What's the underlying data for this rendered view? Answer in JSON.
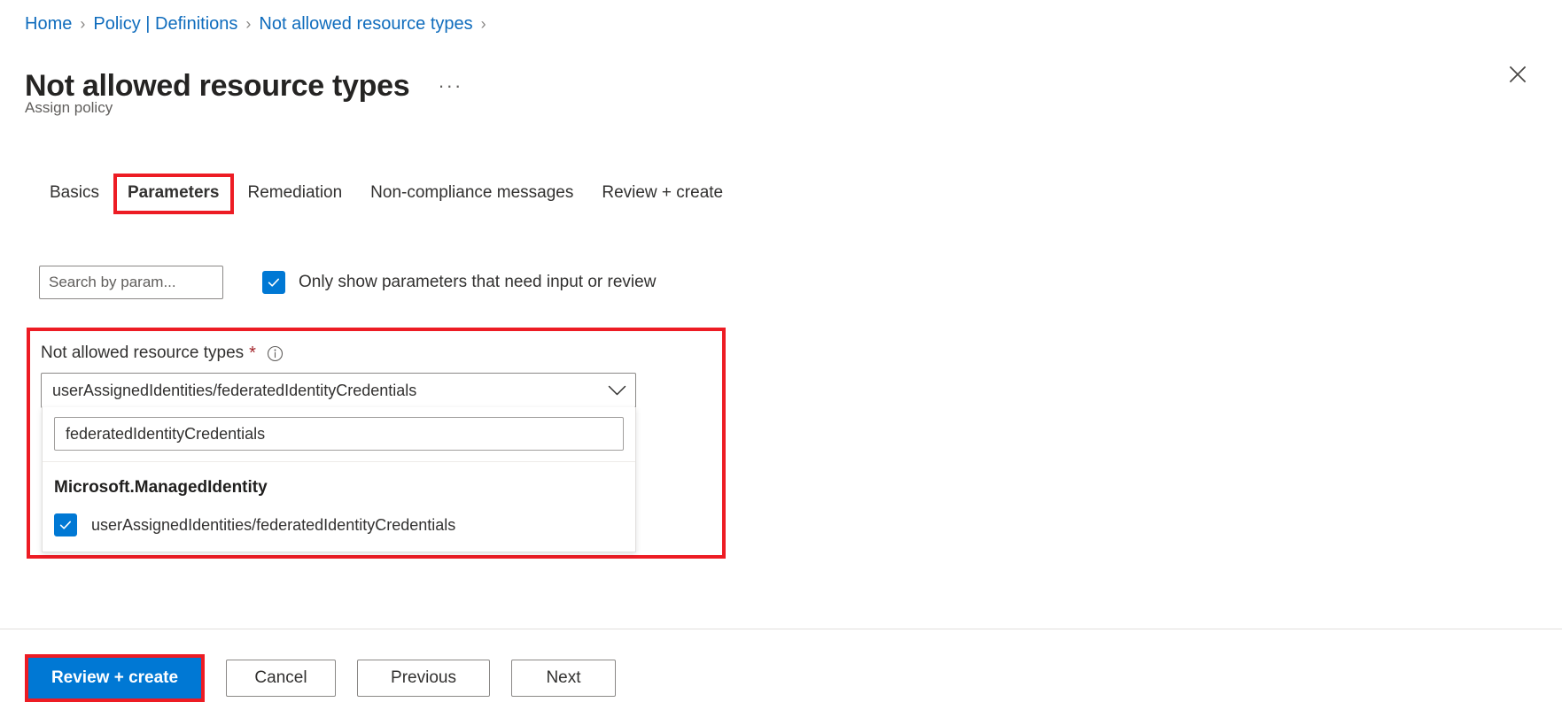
{
  "breadcrumb": {
    "separator": "›",
    "items": [
      {
        "label": "Home"
      },
      {
        "label": "Policy | Definitions"
      },
      {
        "label": "Not allowed resource types"
      }
    ]
  },
  "header": {
    "title": "Not allowed resource types",
    "subtitle": "Assign policy",
    "more_menu": "···",
    "close_icon": "close-icon"
  },
  "tabs": [
    {
      "label": "Basics",
      "active": false,
      "highlighted": false
    },
    {
      "label": "Parameters",
      "active": true,
      "highlighted": true
    },
    {
      "label": "Remediation",
      "active": false,
      "highlighted": false
    },
    {
      "label": "Non-compliance messages",
      "active": false,
      "highlighted": false
    },
    {
      "label": "Review + create",
      "active": false,
      "highlighted": false
    }
  ],
  "filters": {
    "search_placeholder": "Search by param...",
    "search_value": "",
    "need_input_checkbox": {
      "label": "Only show parameters that need input or review",
      "checked": true
    }
  },
  "parameter": {
    "label": "Not allowed resource types",
    "required_marker": "*",
    "info_icon": "info-icon",
    "combo_value": "userAssignedIdentities/federatedIdentityCredentials",
    "chevron_icon": "chevron-down-icon",
    "dropdown": {
      "search_value": "federatedIdentityCredentials",
      "search_placeholder": "",
      "group_header": "Microsoft.ManagedIdentity",
      "options": [
        {
          "label": "userAssignedIdentities/federatedIdentityCredentials",
          "checked": true
        }
      ]
    }
  },
  "footer": {
    "primary_button": "Review + create",
    "cancel_button": "Cancel",
    "previous_button": "Previous",
    "next_button": "Next"
  },
  "colors": {
    "annotation_red": "#ED1C24",
    "accent_blue": "#0078D4",
    "link_blue": "#0F6CBD",
    "required_red": "#A4262C"
  }
}
